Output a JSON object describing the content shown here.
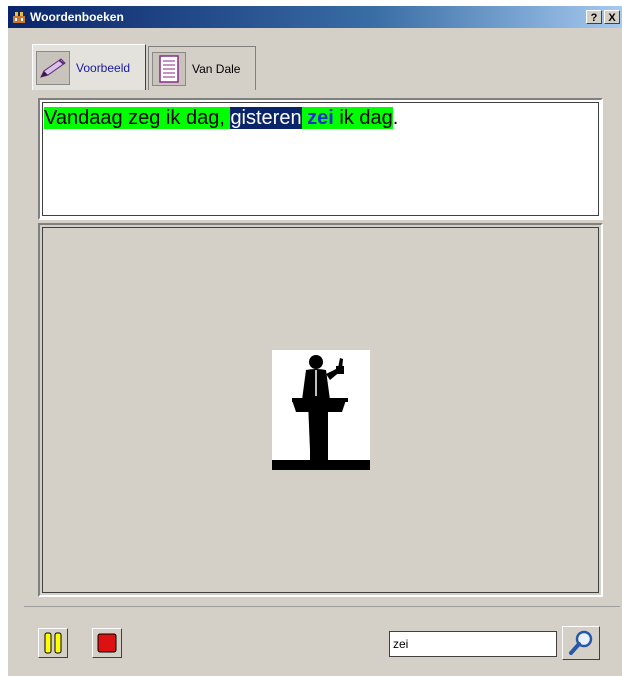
{
  "window": {
    "title": "Woordenboeken",
    "help_glyph": "?",
    "close_glyph": "X"
  },
  "tabs": [
    {
      "label": "Voorbeeld",
      "icon": "pencil-icon",
      "active": true
    },
    {
      "label": "Van Dale",
      "icon": "document-icon",
      "active": false
    }
  ],
  "sentence": {
    "part1": "Vandaag zeg ik dag, ",
    "part2": "gisteren",
    "part3": " ",
    "part4": "zei",
    "part5": " ik dag",
    "part6": "."
  },
  "illustration": "speaker-at-podium-icon",
  "controls": {
    "pause_icon": "pause-icon",
    "stop_icon": "stop-icon"
  },
  "search": {
    "value": "zei",
    "icon": "magnifier-icon"
  },
  "colors": {
    "highlight_green": "#00ff00",
    "highlight_navy": "#0a246a",
    "highlight_word": "#1a34c8",
    "pause_yellow": "#ffff00",
    "stop_red": "#dd1111"
  }
}
